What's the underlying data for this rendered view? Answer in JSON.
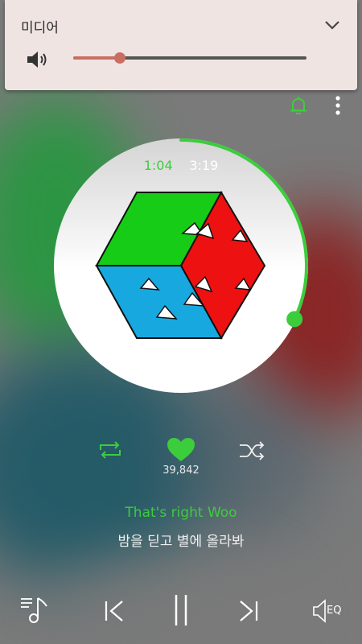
{
  "volume_panel": {
    "title": "미디어",
    "level": 0.2
  },
  "player": {
    "current_time": "1:04",
    "total_time": "3:19",
    "progress": 0.32,
    "like_count": "39,842",
    "lyrics": {
      "current": "That's right Woo",
      "next": "밤을 딛고 별에 올라봐"
    }
  },
  "bottom_bar": {
    "eq_label": "EQ"
  },
  "colors": {
    "accent": "#3ccd3c",
    "volume_accent": "#c96e63",
    "panel_bg": "#efe4e2"
  },
  "icons": [
    "speaker-icon",
    "chevron-down-icon",
    "bell-icon",
    "more-vert-icon",
    "repeat-icon",
    "heart-icon",
    "shuffle-icon",
    "playlist-icon",
    "previous-icon",
    "pause-icon",
    "next-icon",
    "eq-icon"
  ]
}
